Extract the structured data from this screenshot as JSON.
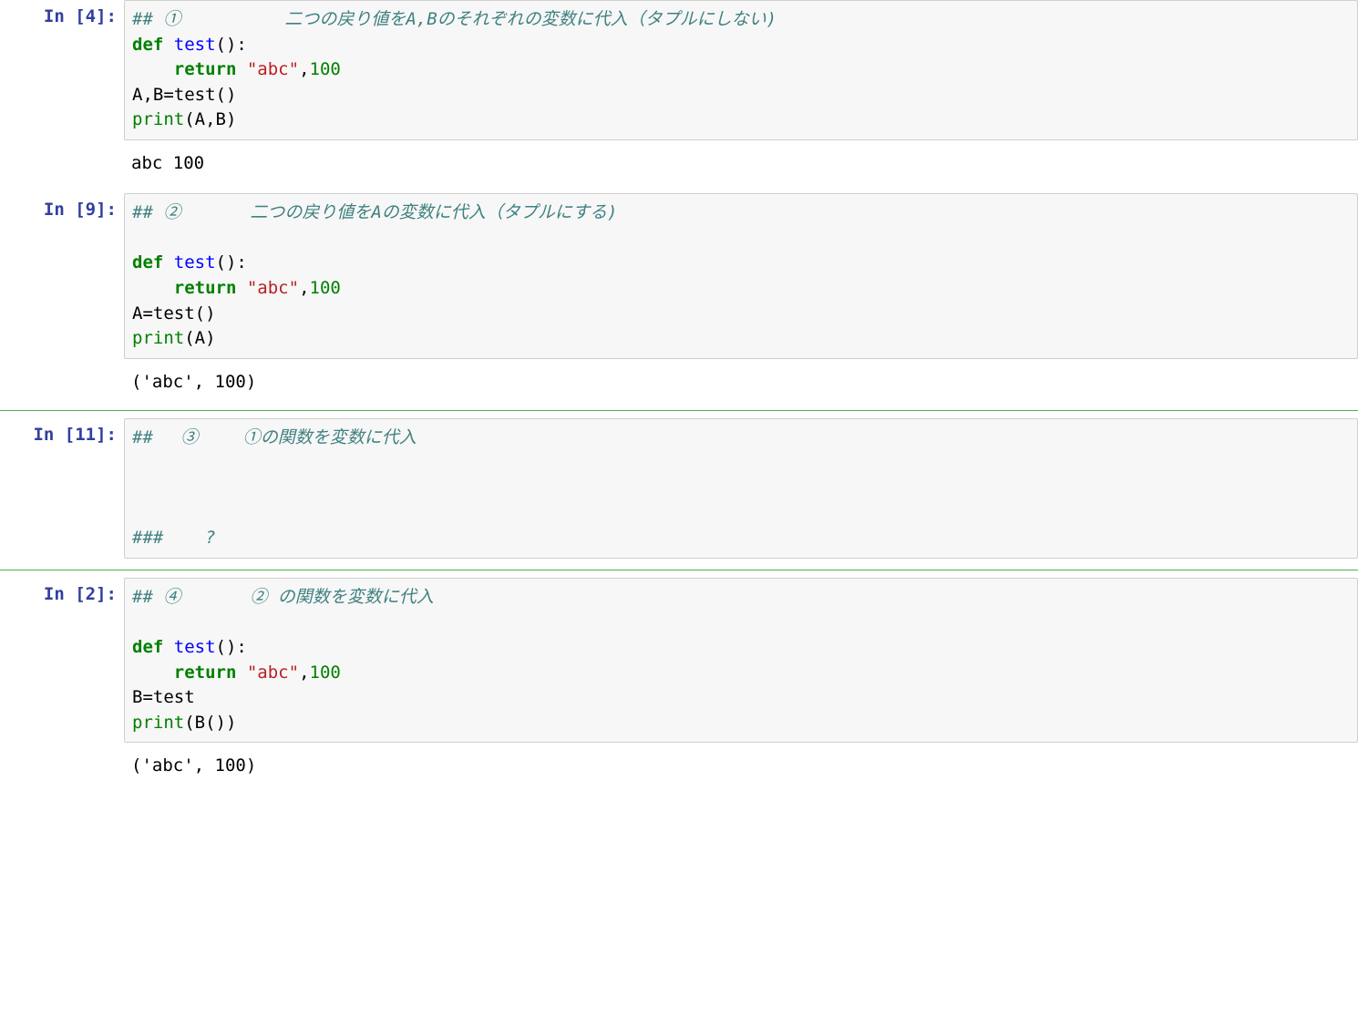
{
  "cells": [
    {
      "prompt": "In [4]:",
      "code_html": "<span class='cm'>## ①　　　　　　二つの戻り値をA,Bのそれぞれの変数に代入（タプルにしない)</span>\n<span class='kw'>def</span> <span class='fn'>test</span>():\n    <span class='kw'>return</span> <span class='str'>\"abc\"</span>,<span class='num'>100</span>\nA,B<span class='nm'>=</span>test()\n<span class='bi'>print</span>(A,B)",
      "output": "abc 100",
      "separator_after": false
    },
    {
      "prompt": "In [9]:",
      "code_html": "<span class='cm'>## ②　　　　二つの戻り値をAの変数に代入（タプルにする)</span>\n\n<span class='kw'>def</span> <span class='fn'>test</span>():\n    <span class='kw'>return</span> <span class='str'>\"abc\"</span>,<span class='num'>100</span>\nA<span class='nm'>=</span>test()\n<span class='bi'>print</span>(A)",
      "output": "('abc', 100)",
      "separator_after": true
    },
    {
      "prompt": "In [11]:",
      "code_html": "<span class='cm'>##　 ③　　 ①の関数を変数に代入</span>\n\n\n\n<span class='cm'>###    ?</span>",
      "output": null,
      "separator_after": true
    },
    {
      "prompt": "In [2]:",
      "code_html": "<span class='cm'>## ④　　　　② の関数を変数に代入</span>\n\n<span class='kw'>def</span> <span class='fn'>test</span>():\n    <span class='kw'>return</span> <span class='str'>\"abc\"</span>,<span class='num'>100</span>\nB<span class='nm'>=</span>test\n<span class='bi'>print</span>(B())",
      "output": "('abc', 100)",
      "separator_after": false
    }
  ]
}
